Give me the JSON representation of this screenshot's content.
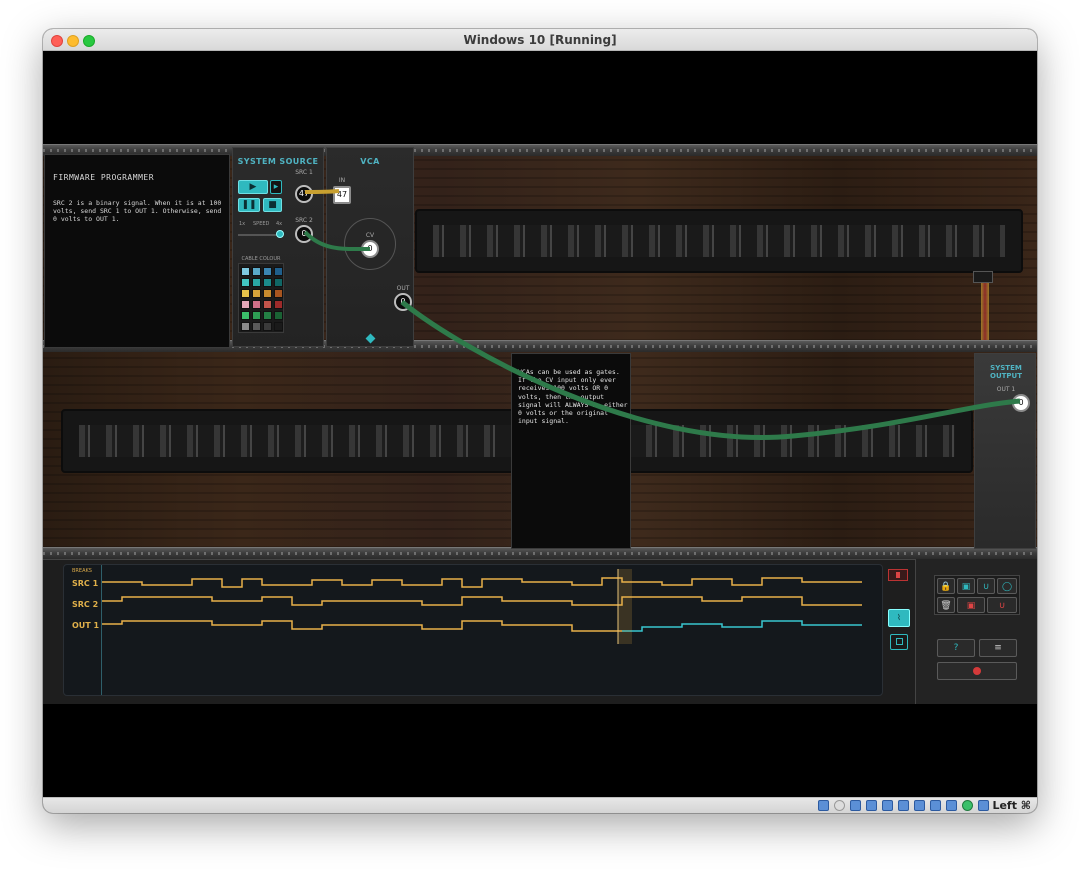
{
  "window": {
    "title": "Windows 10 [Running]"
  },
  "statusbar": {
    "host_key": "Left ⌘"
  },
  "firmware": {
    "title": "FIRMWARE PROGRAMMER",
    "text": "SRC 2 is a binary signal. When it is at 100 volts, send SRC 1 to OUT 1. Otherwise, send 0 volts to OUT 1."
  },
  "system_source": {
    "title": "SYSTEM SOURCE",
    "src1_label": "SRC 1",
    "src1_value": "47",
    "src2_label": "SRC 2",
    "src2_value": "0",
    "speed_label": "SPEED",
    "speed_min": "1x",
    "speed_max": "4x",
    "cable_colour_label": "CABLE COLOUR",
    "swatches": [
      "#7ec9e0",
      "#5aa9c9",
      "#3b86b3",
      "#1f5f8c",
      "#42c6c2",
      "#2aa7a5",
      "#1b8a8a",
      "#106766",
      "#e6c24a",
      "#d6a33a",
      "#c78a2e",
      "#a8551f",
      "#e4a8b8",
      "#d07088",
      "#c2544a",
      "#9e2a2a",
      "#3bbf6a",
      "#2e9c54",
      "#247f44",
      "#1a6234",
      "#8a8a8a",
      "#5a5a5a",
      "#3a3a3a",
      "#1a1a1a"
    ]
  },
  "vca": {
    "title": "VCA",
    "in_label": "IN",
    "in_value": "47",
    "cv_label": "CV",
    "cv_value": "0",
    "out_label": "OUT",
    "out_value": "0"
  },
  "note": {
    "text": "VCAs can be used as gates. If the CV input only ever receives 100 volts OR 0 volts, then the output signal will ALWAYS be either 0 volts or the original input signal."
  },
  "system_output": {
    "title": "SYSTEM OUTPUT",
    "out_label": "OUT 1",
    "out_value": "0"
  },
  "oscilloscope": {
    "breaks_label": "BREAKS",
    "lanes": [
      "SRC 1",
      "SRC 2",
      "OUT 1"
    ],
    "colors": {
      "src": "#e8b04a",
      "out_expected": "#e8b04a",
      "out_actual": "#38c6cf"
    }
  },
  "controls": {
    "help_label": "?",
    "menu_label": "≡"
  }
}
